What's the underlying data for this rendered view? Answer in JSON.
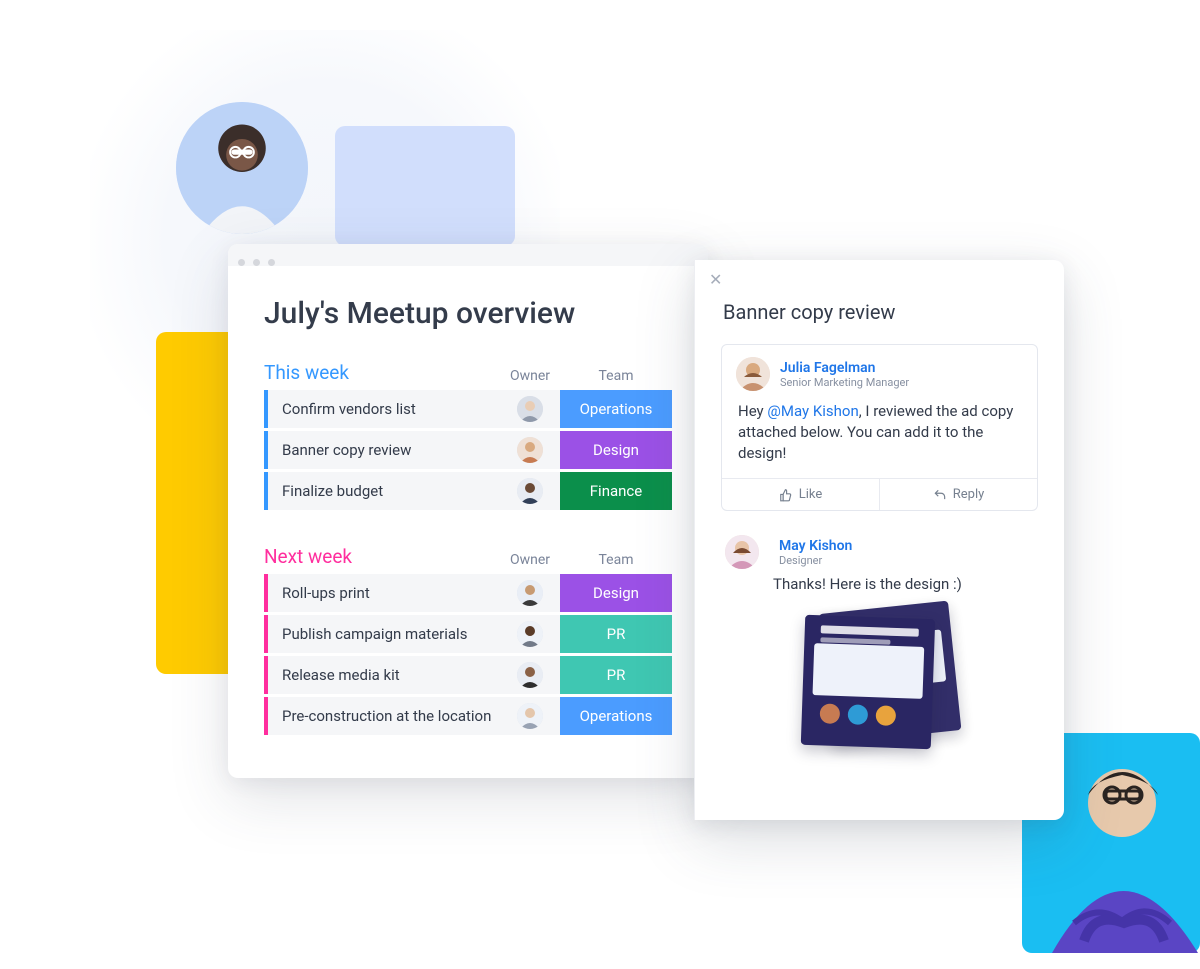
{
  "board": {
    "title": "July's Meetup overview",
    "columns": {
      "owner": "Owner",
      "team": "Team"
    },
    "groups": [
      {
        "title": "This week",
        "color": "blue",
        "tasks": [
          {
            "name": "Confirm vendors list",
            "owner": "p1",
            "team": "Operations",
            "team_color": "#4b9cff"
          },
          {
            "name": "Banner copy review",
            "owner": "p2",
            "team": "Design",
            "team_color": "#9b51e6"
          },
          {
            "name": "Finalize budget",
            "owner": "p3",
            "team": "Finance",
            "team_color": "#0b8f4b"
          }
        ]
      },
      {
        "title": "Next week",
        "color": "pink",
        "tasks": [
          {
            "name": "Roll-ups print",
            "owner": "p4",
            "team": "Design",
            "team_color": "#9b51e6"
          },
          {
            "name": "Publish campaign materials",
            "owner": "p5",
            "team": "PR",
            "team_color": "#3fc7b2"
          },
          {
            "name": "Release media kit",
            "owner": "p6",
            "team": "PR",
            "team_color": "#3fc7b2"
          },
          {
            "name": "Pre-construction at the location",
            "owner": "p7",
            "team": "Operations",
            "team_color": "#4b9cff"
          }
        ]
      }
    ]
  },
  "detail": {
    "title": "Banner copy review",
    "comment": {
      "author": "Julia Fagelman",
      "role": "Senior Marketing Manager",
      "body_pre": "Hey ",
      "mention": "@May Kishon",
      "body_post": ", I reviewed the ad copy attached below. You can add it to the design!",
      "like": "Like",
      "reply": "Reply"
    },
    "reply": {
      "author": "May Kishon",
      "role": "Designer",
      "body": "Thanks! Here is the design :)"
    }
  }
}
